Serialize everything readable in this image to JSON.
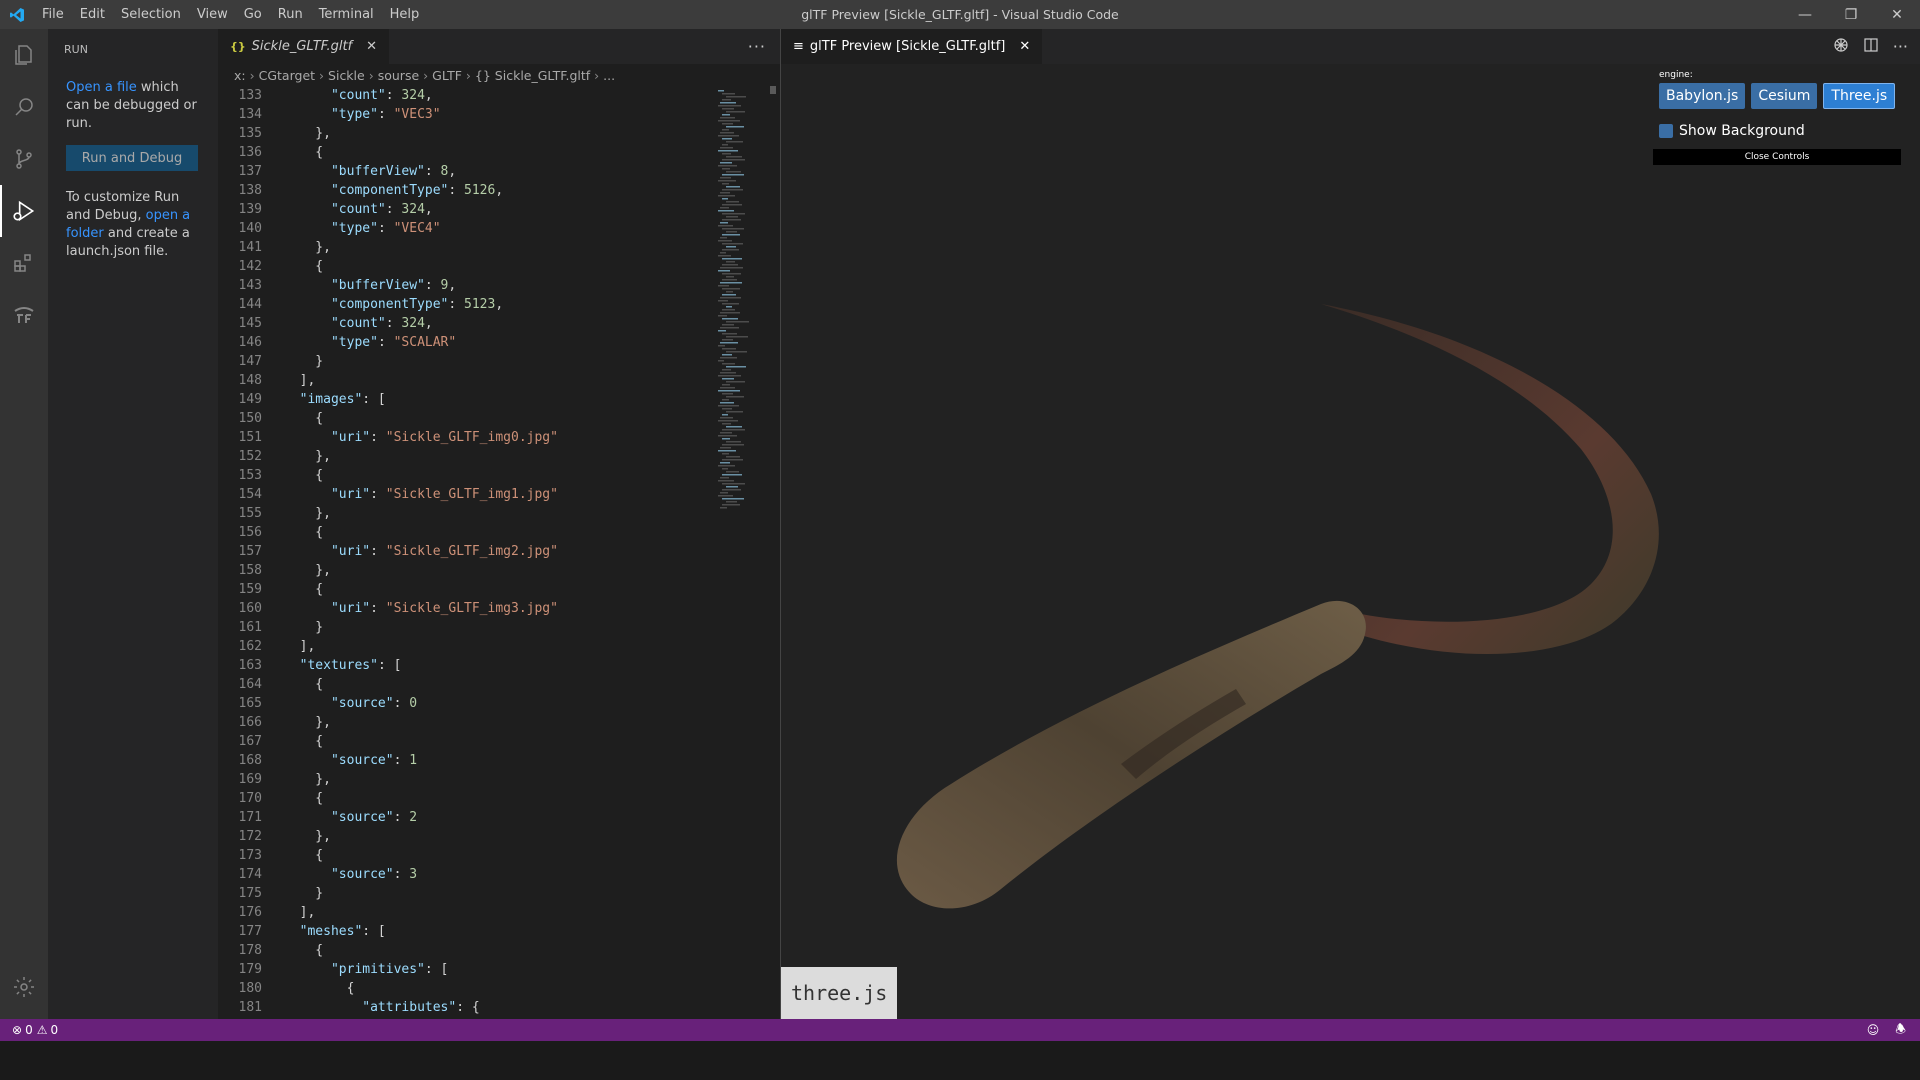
{
  "window": {
    "title": "glTF Preview [Sickle_GLTF.gltf] - Visual Studio Code",
    "menu": [
      "File",
      "Edit",
      "Selection",
      "View",
      "Go",
      "Run",
      "Terminal",
      "Help"
    ],
    "controls": [
      "minimize-icon",
      "restore-icon",
      "close-icon"
    ]
  },
  "activity_bar": [
    "explorer-icon",
    "search-icon",
    "source-control-icon",
    "run-debug-icon",
    "extensions-icon",
    "tf-icon"
  ],
  "sidebar": {
    "title": "RUN",
    "open_file_link": "Open a file",
    "open_file_text": " which can be debugged or run.",
    "run_button": "Run and Debug",
    "customize_pre": "To customize Run and Debug, ",
    "open_folder_link": "open a folder",
    "customize_post": " and create a launch.json file."
  },
  "editor": {
    "tab_label": "Sickle_GLTF.gltf",
    "tab_icon": "{}",
    "breadcrumb": [
      "x:",
      "CGtarget",
      "Sickle",
      "sourse",
      "GLTF",
      "{} Sickle_GLTF.gltf",
      "..."
    ],
    "lines": [
      {
        "n": "133",
        "t": "      \"count\": 324,"
      },
      {
        "n": "134",
        "t": "      \"type\": \"VEC3\""
      },
      {
        "n": "135",
        "t": "    },"
      },
      {
        "n": "136",
        "t": "    {"
      },
      {
        "n": "137",
        "t": "      \"bufferView\": 8,"
      },
      {
        "n": "138",
        "t": "      \"componentType\": 5126,"
      },
      {
        "n": "139",
        "t": "      \"count\": 324,"
      },
      {
        "n": "140",
        "t": "      \"type\": \"VEC4\""
      },
      {
        "n": "141",
        "t": "    },"
      },
      {
        "n": "142",
        "t": "    {"
      },
      {
        "n": "143",
        "t": "      \"bufferView\": 9,"
      },
      {
        "n": "144",
        "t": "      \"componentType\": 5123,"
      },
      {
        "n": "145",
        "t": "      \"count\": 324,"
      },
      {
        "n": "146",
        "t": "      \"type\": \"SCALAR\""
      },
      {
        "n": "147",
        "t": "    }"
      },
      {
        "n": "148",
        "t": "  ],"
      },
      {
        "n": "149",
        "t": "  \"images\": ["
      },
      {
        "n": "150",
        "t": "    {"
      },
      {
        "n": "151",
        "t": "      \"uri\": \"Sickle_GLTF_img0.jpg\""
      },
      {
        "n": "152",
        "t": "    },"
      },
      {
        "n": "153",
        "t": "    {"
      },
      {
        "n": "154",
        "t": "      \"uri\": \"Sickle_GLTF_img1.jpg\""
      },
      {
        "n": "155",
        "t": "    },"
      },
      {
        "n": "156",
        "t": "    {"
      },
      {
        "n": "157",
        "t": "      \"uri\": \"Sickle_GLTF_img2.jpg\""
      },
      {
        "n": "158",
        "t": "    },"
      },
      {
        "n": "159",
        "t": "    {"
      },
      {
        "n": "160",
        "t": "      \"uri\": \"Sickle_GLTF_img3.jpg\""
      },
      {
        "n": "161",
        "t": "    }"
      },
      {
        "n": "162",
        "t": "  ],"
      },
      {
        "n": "163",
        "t": "  \"textures\": ["
      },
      {
        "n": "164",
        "t": "    {"
      },
      {
        "n": "165",
        "t": "      \"source\": 0"
      },
      {
        "n": "166",
        "t": "    },"
      },
      {
        "n": "167",
        "t": "    {"
      },
      {
        "n": "168",
        "t": "      \"source\": 1"
      },
      {
        "n": "169",
        "t": "    },"
      },
      {
        "n": "170",
        "t": "    {"
      },
      {
        "n": "171",
        "t": "      \"source\": 2"
      },
      {
        "n": "172",
        "t": "    },"
      },
      {
        "n": "173",
        "t": "    {"
      },
      {
        "n": "174",
        "t": "      \"source\": 3"
      },
      {
        "n": "175",
        "t": "    }"
      },
      {
        "n": "176",
        "t": "  ],"
      },
      {
        "n": "177",
        "t": "  \"meshes\": ["
      },
      {
        "n": "178",
        "t": "    {"
      },
      {
        "n": "179",
        "t": "      \"primitives\": ["
      },
      {
        "n": "180",
        "t": "        {"
      },
      {
        "n": "181",
        "t": "          \"attributes\": {"
      }
    ]
  },
  "preview": {
    "tab_label": "glTF Preview [Sickle_GLTF.gltf]",
    "engine_label": "engine:",
    "engines": [
      "Babylon.js",
      "Cesium",
      "Three.js"
    ],
    "active_engine": "Three.js",
    "show_background": "Show Background",
    "close_controls": "Close Controls",
    "badge": "three.js"
  },
  "status": {
    "errors": "0",
    "warnings": "0"
  },
  "colors": {
    "accent": "#007acc",
    "status_bar": "#68217a"
  }
}
